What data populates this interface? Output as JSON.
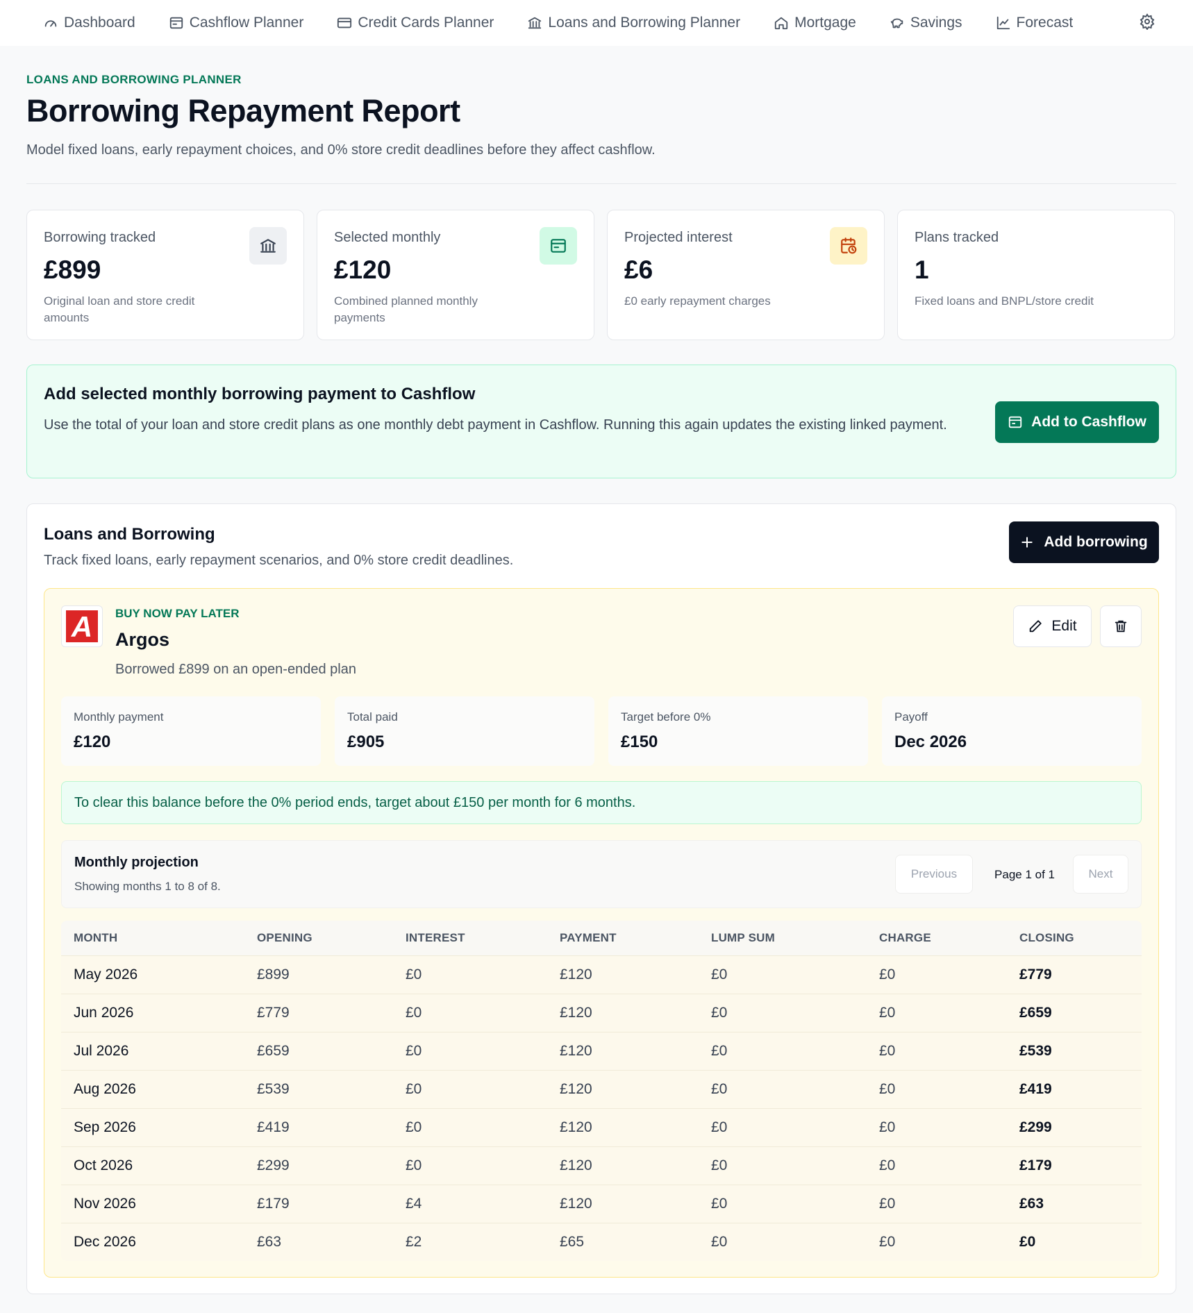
{
  "nav": {
    "items": [
      {
        "label": "Dashboard",
        "icon": "gauge-icon"
      },
      {
        "label": "Cashflow Planner",
        "icon": "wallet-icon"
      },
      {
        "label": "Credit Cards Planner",
        "icon": "credit-card-icon"
      },
      {
        "label": "Loans and Borrowing Planner",
        "icon": "bank-icon"
      },
      {
        "label": "Mortgage",
        "icon": "house-icon"
      },
      {
        "label": "Savings",
        "icon": "piggy-bank-icon"
      },
      {
        "label": "Forecast",
        "icon": "line-chart-icon"
      }
    ],
    "settings_icon": "gear-icon"
  },
  "header": {
    "eyebrow": "LOANS AND BORROWING PLANNER",
    "title": "Borrowing Repayment Report",
    "subtitle": "Model fixed loans, early repayment choices, and 0% store credit deadlines before they affect cashflow."
  },
  "stats": [
    {
      "label": "Borrowing tracked",
      "value": "£899",
      "desc": "Original loan and store credit amounts",
      "icon": "bank-icon",
      "icon_bg": "#eef0f3",
      "icon_color": "#374151"
    },
    {
      "label": "Selected monthly",
      "value": "£120",
      "desc": "Combined planned monthly payments",
      "icon": "wallet-icon",
      "icon_bg": "#d1fae5",
      "icon_color": "#047857"
    },
    {
      "label": "Projected interest",
      "value": "£6",
      "desc": "£0 early repayment charges",
      "icon": "calendar-clock-icon",
      "icon_bg": "#fef3c7",
      "icon_color": "#c2410c"
    },
    {
      "label": "Plans tracked",
      "value": "1",
      "desc": "Fixed loans and BNPL/store credit"
    }
  ],
  "cashflow_banner": {
    "title": "Add selected monthly borrowing payment to Cashflow",
    "text": "Use the total of your loan and store credit plans as one monthly debt payment in Cashflow. Running this again updates the existing linked payment.",
    "button_label": "Add to Cashflow"
  },
  "loans_panel": {
    "title": "Loans and Borrowing",
    "subtitle": "Track fixed loans, early repayment scenarios, and 0% store credit deadlines.",
    "add_button_label": "Add borrowing"
  },
  "plan": {
    "kicker": "BUY NOW PAY LATER",
    "name": "Argos",
    "logo_letter": "A",
    "description": "Borrowed £899 on an open-ended plan",
    "edit_label": "Edit",
    "metrics": [
      {
        "label": "Monthly payment",
        "value": "£120"
      },
      {
        "label": "Total paid",
        "value": "£905"
      },
      {
        "label": "Target before 0%",
        "value": "£150"
      },
      {
        "label": "Payoff",
        "value": "Dec 2026"
      }
    ],
    "hint": "To clear this balance before the 0% period ends, target about £150 per month for 6 months.",
    "projection": {
      "title": "Monthly projection",
      "subtitle": "Showing months 1 to 8 of 8.",
      "prev_label": "Previous",
      "page_label": "Page 1 of 1",
      "next_label": "Next",
      "columns": [
        "MONTH",
        "OPENING",
        "INTEREST",
        "PAYMENT",
        "LUMP SUM",
        "CHARGE",
        "CLOSING"
      ],
      "rows": [
        [
          "May 2026",
          "£899",
          "£0",
          "£120",
          "£0",
          "£0",
          "£779"
        ],
        [
          "Jun 2026",
          "£779",
          "£0",
          "£120",
          "£0",
          "£0",
          "£659"
        ],
        [
          "Jul 2026",
          "£659",
          "£0",
          "£120",
          "£0",
          "£0",
          "£539"
        ],
        [
          "Aug 2026",
          "£539",
          "£0",
          "£120",
          "£0",
          "£0",
          "£419"
        ],
        [
          "Sep 2026",
          "£419",
          "£0",
          "£120",
          "£0",
          "£0",
          "£299"
        ],
        [
          "Oct 2026",
          "£299",
          "£0",
          "£120",
          "£0",
          "£0",
          "£179"
        ],
        [
          "Nov 2026",
          "£179",
          "£4",
          "£120",
          "£0",
          "£0",
          "£63"
        ],
        [
          "Dec 2026",
          "£63",
          "£2",
          "£65",
          "£0",
          "£0",
          "£0"
        ]
      ]
    }
  },
  "colors": {
    "accent_green": "#047857",
    "dark_button": "#0b1220",
    "plan_background": "#fefbeb",
    "logo_red": "#dc2626"
  }
}
